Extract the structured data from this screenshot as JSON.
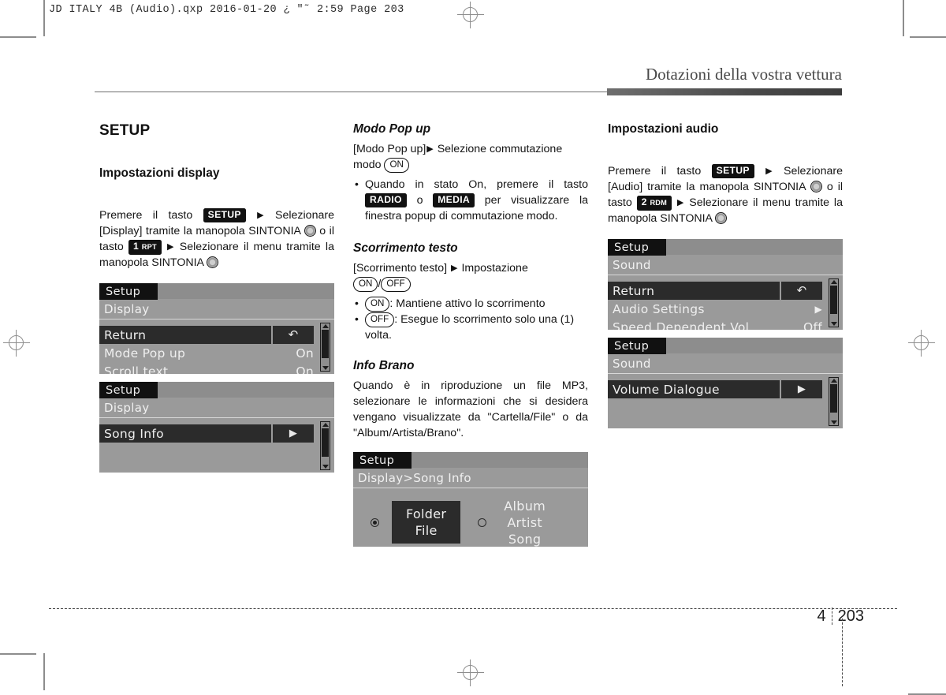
{
  "print_marks": {
    "file_header": "JD ITALY 4B (Audio).qxp   2016-01-20   ¿ \"˜ 2:59   Page 203"
  },
  "running_head": {
    "title": "Dotazioni della vostra vettura"
  },
  "footer": {
    "chapter": "4",
    "page": "203"
  },
  "columns": {
    "left": {
      "section_title": "SETUP",
      "sub_title": "Impostazioni display",
      "intro": {
        "p1": "Premere il tasto",
        "badge_setup": "SETUP",
        "p2": "Selezionare [Display] tramite la manopola SINTONIA",
        "p3": "o il tasto",
        "badge_1rpt_num": "1",
        "badge_1rpt_txt": "RPT",
        "p4": "Selezionare il menu tramite la manopola SINTONIA"
      },
      "lcd1": {
        "title": "Setup",
        "crumb": "Display",
        "rows": [
          {
            "label": "Return",
            "value": "",
            "selected": true,
            "icon": "return-icon"
          },
          {
            "label": "Mode Pop up",
            "value": "On",
            "selected": false
          },
          {
            "label": "Scroll text",
            "value": "On",
            "selected": false
          }
        ]
      },
      "lcd2": {
        "title": "Setup",
        "crumb": "Display",
        "rows": [
          {
            "label": "Song Info",
            "value": "",
            "selected": true,
            "icon": "chevron-right-icon"
          }
        ]
      }
    },
    "middle": {
      "modo_popup": {
        "heading": "Modo Pop up",
        "line1a": "[Modo Pop up]",
        "line1b": "Selezione commutazione modo",
        "pill_on": "ON",
        "bullet1a": "Quando in stato On, premere il tasto",
        "badge_radio": "RADIO",
        "bullet1b": "o",
        "badge_media": "MEDIA",
        "bullet1c": "per visualizzare la finestra popup di commutazione modo."
      },
      "scorrimento": {
        "heading": "Scorrimento testo",
        "line1a": "[Scorrimento testo]",
        "line1b": "Impostazione",
        "pill_on": "ON",
        "pill_slash": "/",
        "pill_off": "OFF",
        "bullet_on_pill": "ON",
        "bullet_on_text": ": Mantiene attivo lo scorrimento",
        "bullet_off_pill": "OFF",
        "bullet_off_text": ": Esegue lo scorrimento solo una (1) volta."
      },
      "info_brano": {
        "heading": "Info Brano",
        "body": "Quando è in riproduzione un file MP3, selezionare le informazioni che si desidera vengano visualizzate da \"Cartella/File\" o da \"Album/Artista/Brano\"."
      },
      "lcd3": {
        "title": "Setup",
        "crumb": "Display>Song Info",
        "option_selected": {
          "line1": "Folder",
          "line2": "File",
          "checked": true
        },
        "option_other": {
          "line1": "Album",
          "line2": "Artist",
          "line3": "Song",
          "checked": false
        }
      }
    },
    "right": {
      "sub_title": "Impostazioni audio",
      "intro": {
        "p1": "Premere il tasto",
        "badge_setup": "SETUP",
        "p2": "Selezionare [Audio] tramite la manopola SINTONIA",
        "p3": "o il tasto",
        "badge_2rdm_num": "2",
        "badge_2rdm_txt": "RDM",
        "p4": "Selezionare il menu tramite la manopola SINTONIA"
      },
      "lcd4": {
        "title": "Setup",
        "crumb": "Sound",
        "rows": [
          {
            "label": "Return",
            "value": "",
            "selected": true,
            "icon": "return-icon"
          },
          {
            "label": "Audio Settings",
            "value": "▶",
            "selected": false
          },
          {
            "label": "Speed Dependent Vol.",
            "value": "Off",
            "selected": false
          }
        ]
      },
      "lcd5": {
        "title": "Setup",
        "crumb": "Sound",
        "rows": [
          {
            "label": "Volume Dialogue",
            "value": "",
            "selected": true,
            "icon": "chevron-right-icon"
          }
        ]
      }
    }
  },
  "colors": {
    "lcd_bg": "#9a9a9a",
    "lcd_dark": "#2b2b2b",
    "ink": "#141414",
    "rule": "#4a4a4a"
  }
}
